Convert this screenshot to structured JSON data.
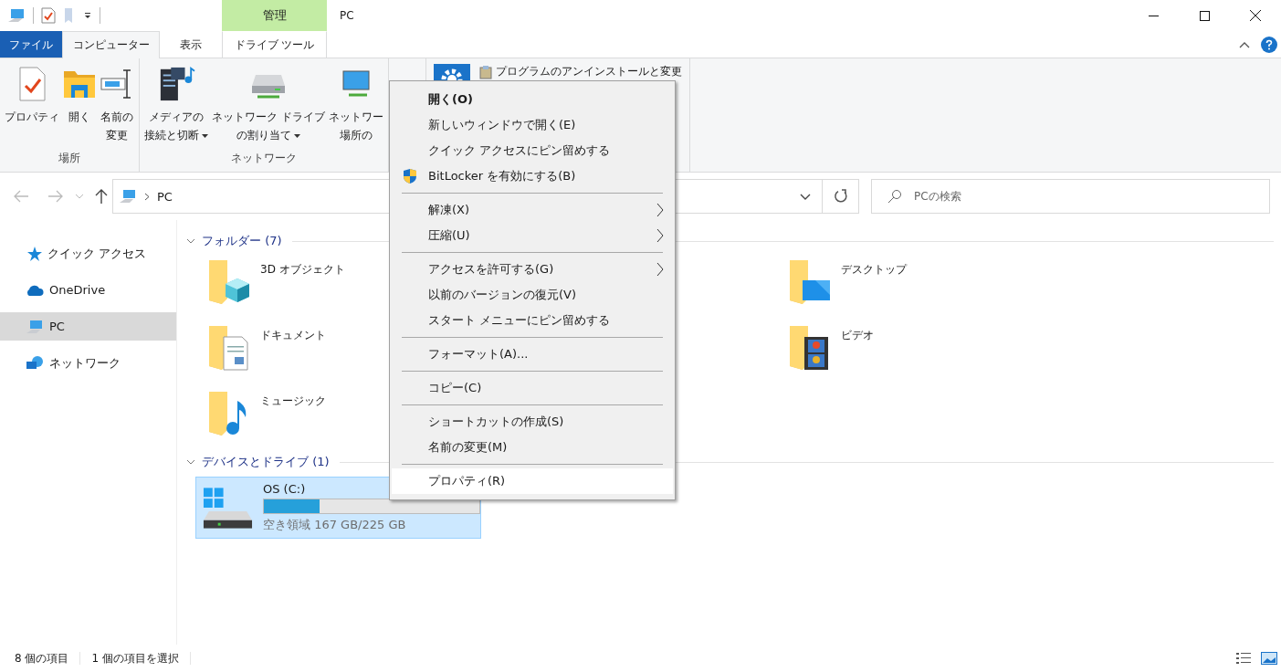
{
  "window": {
    "title": "PC",
    "contextual_group": "管理"
  },
  "ribbon_tabs": [
    {
      "label": "ファイル",
      "kind": "file",
      "selected": false
    },
    {
      "label": "コンピューター",
      "kind": "tab",
      "selected": true
    },
    {
      "label": "表示",
      "kind": "tab",
      "selected": false
    },
    {
      "label": "ドライブ ツール",
      "kind": "contextual",
      "selected": false
    }
  ],
  "ribbon_groups": [
    {
      "label": "場所",
      "buttons": [
        {
          "lines": [
            "プロパティ"
          ],
          "dropdown": false
        },
        {
          "lines": [
            "開く"
          ],
          "dropdown": false
        },
        {
          "lines": [
            "名前の",
            "変更"
          ],
          "dropdown": false
        }
      ]
    },
    {
      "label": "ネットワーク",
      "buttons": [
        {
          "lines": [
            "メディアの",
            "接続と切断"
          ],
          "dropdown": true
        },
        {
          "lines": [
            "ネットワーク ドライブ",
            "の割り当て"
          ],
          "dropdown": true
        },
        {
          "lines": [
            "ネットワー",
            "場所の"
          ],
          "dropdown": false
        }
      ]
    }
  ],
  "ribbon_system": {
    "command": "プログラムのアンインストールと変更"
  },
  "navigation": {
    "address_path": "PC",
    "search": {
      "placeholder": "PCの検索"
    }
  },
  "sidebar": {
    "items": [
      {
        "label": "クイック アクセス",
        "selected": false
      },
      {
        "label": "OneDrive",
        "selected": false
      },
      {
        "label": "PC",
        "selected": true
      },
      {
        "label": "ネットワーク",
        "selected": false
      }
    ]
  },
  "folders_group": {
    "header": "フォルダー (7)",
    "items": [
      {
        "name": "3D オブジェクト"
      },
      {
        "name": "デスクトップ"
      },
      {
        "name": "ドキュメント"
      },
      {
        "name": "ビデオ"
      },
      {
        "name": "ミュージック"
      }
    ]
  },
  "devices_group": {
    "header": "デバイスとドライブ (1)",
    "drives": [
      {
        "name": "OS (C:)",
        "level": 0.26,
        "free_space": "空き領域 167 GB/225 GB",
        "selected": true
      }
    ]
  },
  "context_menu": {
    "items": [
      {
        "kind": "text",
        "label": "開く(O)",
        "default": true,
        "submenu": false,
        "selected": false
      },
      {
        "kind": "text",
        "label": "新しいウィンドウで開く(E)",
        "default": false,
        "submenu": false,
        "selected": false
      },
      {
        "kind": "text",
        "label": "クイック アクセスにピン留めする",
        "default": false,
        "submenu": false,
        "selected": false
      },
      {
        "kind": "icon",
        "label": "BitLocker を有効にする(B)",
        "default": false,
        "submenu": false,
        "selected": false
      },
      {
        "kind": "separator"
      },
      {
        "kind": "text",
        "label": "解凍(X)",
        "default": false,
        "submenu": true,
        "selected": false
      },
      {
        "kind": "text",
        "label": "圧縮(U)",
        "default": false,
        "submenu": true,
        "selected": false
      },
      {
        "kind": "separator"
      },
      {
        "kind": "text",
        "label": "アクセスを許可する(G)",
        "default": false,
        "submenu": true,
        "selected": false
      },
      {
        "kind": "text",
        "label": "以前のバージョンの復元(V)",
        "default": false,
        "submenu": false,
        "selected": false
      },
      {
        "kind": "text",
        "label": "スタート メニューにピン留めする",
        "default": false,
        "submenu": false,
        "selected": false
      },
      {
        "kind": "separator"
      },
      {
        "kind": "text",
        "label": "フォーマット(A)...",
        "default": false,
        "submenu": false,
        "selected": false
      },
      {
        "kind": "separator"
      },
      {
        "kind": "text",
        "label": "コピー(C)",
        "default": false,
        "submenu": false,
        "selected": false
      },
      {
        "kind": "separator"
      },
      {
        "kind": "text",
        "label": "ショートカットの作成(S)",
        "default": false,
        "submenu": false,
        "selected": false
      },
      {
        "kind": "text",
        "label": "名前の変更(M)",
        "default": false,
        "submenu": false,
        "selected": false
      },
      {
        "kind": "separator"
      },
      {
        "kind": "text",
        "label": "プロパティ(R)",
        "default": false,
        "submenu": false,
        "selected": true
      }
    ]
  },
  "status_bar": {
    "item_count": "8 個の項目",
    "selection": "1 個の項目を選択"
  }
}
